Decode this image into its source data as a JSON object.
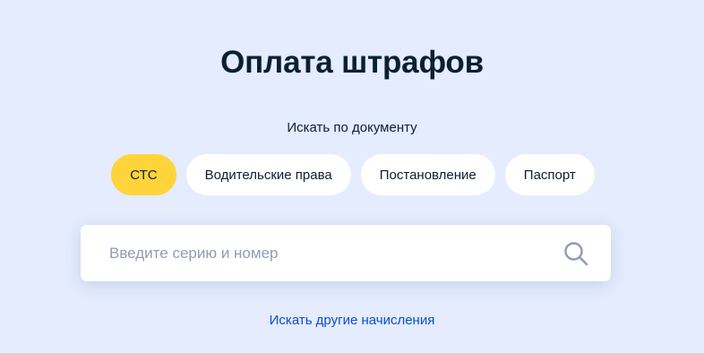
{
  "page": {
    "title": "Оплата штрафов",
    "document_label": "Искать по документу"
  },
  "document_types": [
    {
      "label": "СТС",
      "selected": true
    },
    {
      "label": "Водительские права",
      "selected": false
    },
    {
      "label": "Постановление",
      "selected": false
    },
    {
      "label": "Паспорт",
      "selected": false
    }
  ],
  "search": {
    "value": "",
    "placeholder": "Введите серию и номер",
    "icon": "search-icon"
  },
  "links": {
    "other_charges": "Искать другие начисления"
  },
  "colors": {
    "background": "#e4ecfd",
    "chip_active": "#ffd43b",
    "chip_inactive": "#ffffff",
    "text": "#0b1f33",
    "link": "#0d4cd3",
    "placeholder": "#8f9db3"
  }
}
